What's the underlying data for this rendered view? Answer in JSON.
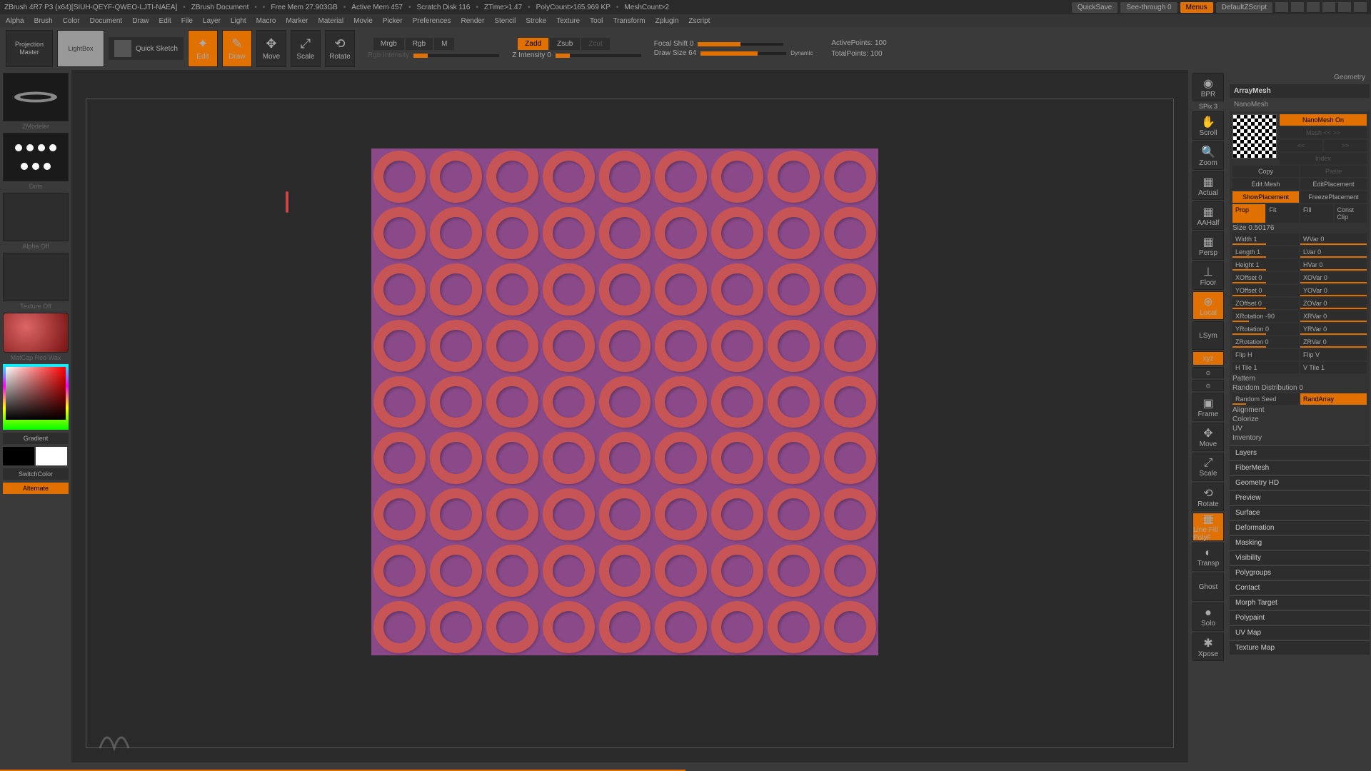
{
  "title": {
    "app": "ZBrush 4R7 P3 (x64)[SIUH-QEYF-QWEO-LJTI-NAEA]",
    "doc": "ZBrush Document",
    "freemem": "Free Mem 27.903GB",
    "activemem": "Active Mem 457",
    "scratch": "Scratch Disk 116",
    "ztime": "ZTime>1.47",
    "polycount": "PolyCount>165.969 KP",
    "meshcount": "MeshCount>2",
    "quicksave": "QuickSave",
    "seethrough": "See-through  0",
    "menus": "Menus",
    "script": "DefaultZScript"
  },
  "menu": [
    "Alpha",
    "Brush",
    "Color",
    "Document",
    "Draw",
    "Edit",
    "File",
    "Layer",
    "Light",
    "Macro",
    "Marker",
    "Material",
    "Movie",
    "Picker",
    "Preferences",
    "Render",
    "Stencil",
    "Stroke",
    "Texture",
    "Tool",
    "Transform",
    "Zplugin",
    "Zscript"
  ],
  "toolbar": {
    "projection": "Projection Master",
    "lightbox": "LightBox",
    "quicksketch": "Quick Sketch",
    "edit": "Edit",
    "draw": "Draw",
    "move": "Move",
    "scale": "Scale",
    "rotate": "Rotate",
    "mrgb": "Mrgb",
    "rgb": "Rgb",
    "m": "M",
    "rgbint": "Rgb Intensity",
    "zadd": "Zadd",
    "zsub": "Zsub",
    "zcut": "Zcut",
    "zint": "Z Intensity 0",
    "focal": "Focal Shift 0",
    "drawsize": "Draw Size 64",
    "dynamic": "Dynamic",
    "activepoints": "ActivePoints: 100",
    "totalpoints": "TotalPoints: 100"
  },
  "left": {
    "zmodeler": "ZModeler",
    "dots": "Dots",
    "alphaoff": "Alpha  Off",
    "textureoff": "Texture  Off",
    "matcap": "MatCap Red Wax",
    "gradient": "Gradient",
    "switchcolor": "SwitchColor",
    "alternate": "Alternate"
  },
  "rightTools": [
    "BPR",
    "SPix 3",
    "Scroll",
    "Zoom",
    "Actual",
    "AAHalf",
    "Persp",
    "Floor",
    "Local",
    "LSym",
    "xyz",
    "",
    "",
    "Frame",
    "Move",
    "Scale",
    "Rotate",
    "Line Fill PolyF",
    "Transp",
    "Ghost",
    "Solo",
    "Xpose"
  ],
  "panel": {
    "geometry": "Geometry",
    "arraymesh": "ArrayMesh",
    "nanomesh": "NanoMesh",
    "nanoOn": "NanoMesh On",
    "editmesh": "Edit Mesh",
    "editplace": "EditPlacement",
    "showplace": "ShowPlacement",
    "freezeplace": "FreezePlacement",
    "copy": "Copy",
    "paste": "Paste",
    "prop": "Prop",
    "fit": "Fit",
    "fill": "Fill",
    "constclip": "Const Clip",
    "size": "Size 0.50176",
    "width": "Width 1",
    "wvar": "WVar 0",
    "length": "Length 1",
    "lvar": "LVar 0",
    "height": "Height 1",
    "hvar": "HVar 0",
    "xoff": "XOffset 0",
    "xovar": "XOVar 0",
    "yoff": "YOffset 0",
    "yovar": "YOVar 0",
    "zoff": "ZOffset 0",
    "zovar": "ZOVar 0",
    "xrot": "XRotation -90",
    "xrvar": "XRVar 0",
    "yrot": "YRotation 0",
    "yrvar": "YRVar 0",
    "zrot": "ZRotation 0",
    "zrvar": "ZRVar 0",
    "fliph": "Flip H",
    "flipv": "Flip V",
    "htile": "H Tile 1",
    "vtile": "V Tile 1",
    "pattern": "Pattern",
    "randdist": "Random Distribution 0",
    "randseed": "Random Seed",
    "randarray": "RandArray",
    "alignment": "Alignment",
    "colorize": "Colorize",
    "uv": "UV",
    "inventory": "Inventory"
  },
  "sections": [
    "Layers",
    "FiberMesh",
    "Geometry HD",
    "Preview",
    "Surface",
    "Deformation",
    "Masking",
    "Visibility",
    "Polygroups",
    "Contact",
    "Morph Target",
    "Polypaint",
    "UV Map",
    "Texture Map"
  ]
}
